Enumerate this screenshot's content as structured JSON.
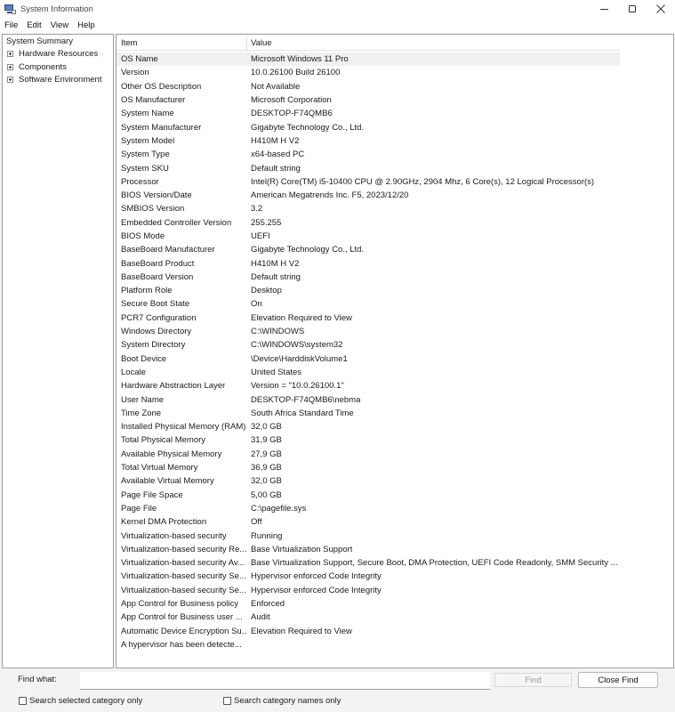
{
  "window": {
    "title": "System Information",
    "app_icon": "system-information-icon",
    "controls": [
      "minimize-icon",
      "maximize-icon",
      "close-icon"
    ]
  },
  "menu": [
    "File",
    "Edit",
    "View",
    "Help"
  ],
  "tree": {
    "root": "System Summary",
    "children": [
      "Hardware Resources",
      "Components",
      "Software Environment"
    ]
  },
  "list": {
    "headers": {
      "item": "Item",
      "value": "Value"
    },
    "rows": [
      {
        "item": "OS Name",
        "value": "Microsoft Windows 11 Pro"
      },
      {
        "item": "Version",
        "value": "10.0.26100 Build 26100"
      },
      {
        "item": "Other OS Description",
        "value": "Not Available"
      },
      {
        "item": "OS Manufacturer",
        "value": "Microsoft Corporation"
      },
      {
        "item": "System Name",
        "value": "DESKTOP-F74QMB6"
      },
      {
        "item": "System Manufacturer",
        "value": "Gigabyte Technology Co., Ltd."
      },
      {
        "item": "System Model",
        "value": "H410M H V2"
      },
      {
        "item": "System Type",
        "value": "x64-based PC"
      },
      {
        "item": "System SKU",
        "value": "Default string"
      },
      {
        "item": "Processor",
        "value": "Intel(R) Core(TM) i5-10400 CPU @ 2.90GHz, 2904 Mhz, 6 Core(s), 12 Logical Processor(s)"
      },
      {
        "item": "BIOS Version/Date",
        "value": "American Megatrends Inc. F5, 2023/12/20"
      },
      {
        "item": "SMBIOS Version",
        "value": "3.2"
      },
      {
        "item": "Embedded Controller Version",
        "value": "255.255"
      },
      {
        "item": "BIOS Mode",
        "value": "UEFI"
      },
      {
        "item": "BaseBoard Manufacturer",
        "value": "Gigabyte Technology Co., Ltd."
      },
      {
        "item": "BaseBoard Product",
        "value": "H410M H V2"
      },
      {
        "item": "BaseBoard Version",
        "value": "Default string"
      },
      {
        "item": "Platform Role",
        "value": "Desktop"
      },
      {
        "item": "Secure Boot State",
        "value": "On"
      },
      {
        "item": "PCR7 Configuration",
        "value": "Elevation Required to View"
      },
      {
        "item": "Windows Directory",
        "value": "C:\\WINDOWS"
      },
      {
        "item": "System Directory",
        "value": "C:\\WINDOWS\\system32"
      },
      {
        "item": "Boot Device",
        "value": "\\Device\\HarddiskVolume1"
      },
      {
        "item": "Locale",
        "value": "United States"
      },
      {
        "item": "Hardware Abstraction Layer",
        "value": "Version = \"10.0.26100.1\""
      },
      {
        "item": "User Name",
        "value": "DESKTOP-F74QMB6\\nebma"
      },
      {
        "item": "Time Zone",
        "value": "South Africa Standard Time"
      },
      {
        "item": "Installed Physical Memory (RAM)",
        "value": "32,0 GB"
      },
      {
        "item": "Total Physical Memory",
        "value": "31,9 GB"
      },
      {
        "item": "Available Physical Memory",
        "value": "27,9 GB"
      },
      {
        "item": "Total Virtual Memory",
        "value": "36,9 GB"
      },
      {
        "item": "Available Virtual Memory",
        "value": "32,0 GB"
      },
      {
        "item": "Page File Space",
        "value": "5,00 GB"
      },
      {
        "item": "Page File",
        "value": "C:\\pagefile.sys"
      },
      {
        "item": "Kernel DMA Protection",
        "value": "Off"
      },
      {
        "item": "Virtualization-based security",
        "value": "Running"
      },
      {
        "item": "Virtualization-based security Re...",
        "value": "Base Virtualization Support"
      },
      {
        "item": "Virtualization-based security Av...",
        "value": "Base Virtualization Support, Secure Boot, DMA Protection, UEFI Code Readonly, SMM Security ..."
      },
      {
        "item": "Virtualization-based security Se...",
        "value": "Hypervisor enforced Code Integrity"
      },
      {
        "item": "Virtualization-based security Se...",
        "value": "Hypervisor enforced Code Integrity"
      },
      {
        "item": "App Control for Business policy",
        "value": "Enforced"
      },
      {
        "item": "App Control for Business user ...",
        "value": "Audit"
      },
      {
        "item": "Automatic Device Encryption Su...",
        "value": "Elevation Required to View"
      },
      {
        "item": "A hypervisor has been detecte...",
        "value": ""
      }
    ]
  },
  "find": {
    "label": "Find what:",
    "input_value": "",
    "find_button": "Find",
    "close_button": "Close Find",
    "checkbox_selected_category": "Search selected category only",
    "checkbox_category_names": "Search category names only"
  }
}
